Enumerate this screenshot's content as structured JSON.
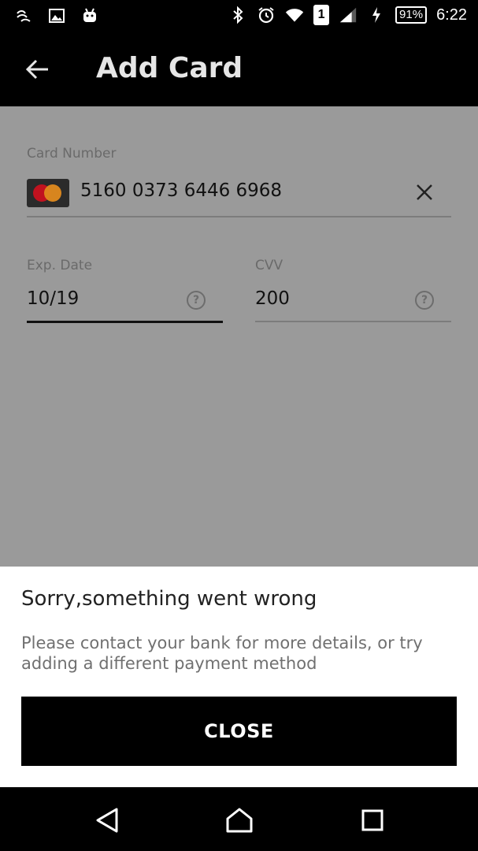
{
  "status_bar": {
    "battery": "91%",
    "time": "6:22",
    "sim": "1",
    "left_icons": [
      "link-icon",
      "image-icon",
      "android-icon"
    ],
    "right_icons": [
      "bluetooth-icon",
      "alarm-icon",
      "wifi-icon",
      "sim-icon",
      "signal-icon",
      "charging-icon"
    ]
  },
  "app_bar": {
    "title": "Add Card",
    "back_icon": "arrow-left-icon"
  },
  "form": {
    "card_number": {
      "label": "Card Number",
      "value": "5160 0373 6446 6968",
      "brand_icon": "mastercard-icon",
      "clear_icon": "close-icon"
    },
    "exp_date": {
      "label": "Exp. Date",
      "value": "10/19",
      "help_icon": "question-circle-icon"
    },
    "cvv": {
      "label": "CVV",
      "value": "200",
      "help_icon": "question-circle-icon"
    }
  },
  "sheet": {
    "title": "Sorry,something went wrong",
    "message": "Please contact your bank for more details, or try adding a different payment method",
    "button_label": "CLOSE"
  },
  "nav_bar": {
    "icons": [
      "back-triangle-icon",
      "home-icon",
      "recents-icon"
    ]
  },
  "colors": {
    "dim_overlay": "#9a9a9a",
    "sheet_bg": "#ffffff",
    "button_bg": "#000000"
  }
}
